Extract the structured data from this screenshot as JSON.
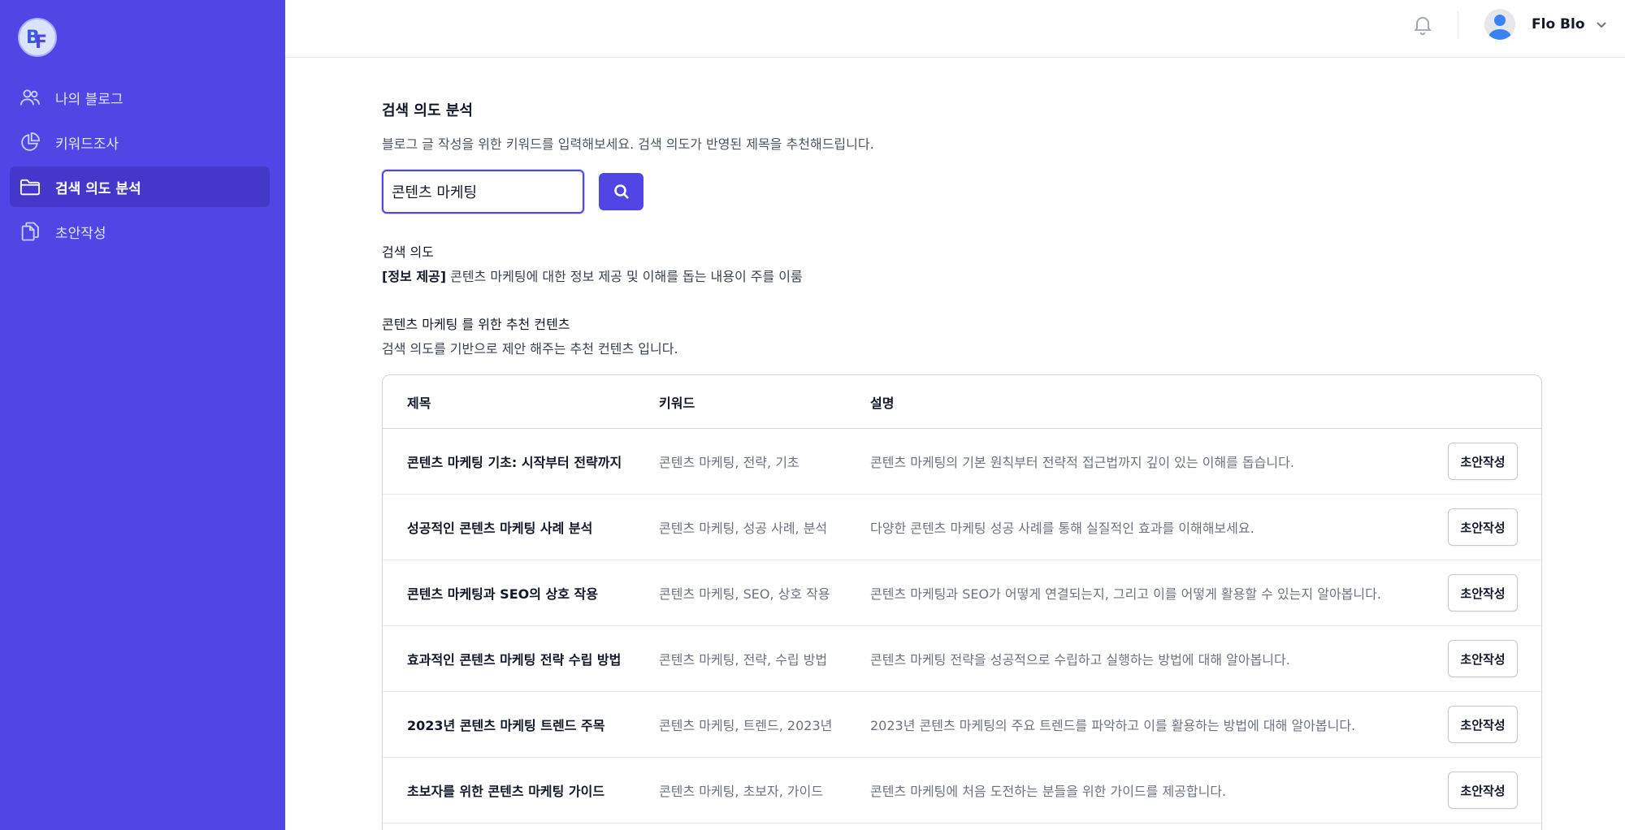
{
  "sidebar": {
    "logo_text": "BF",
    "items": [
      {
        "label": "나의 블로그",
        "icon": "users-icon",
        "active": false
      },
      {
        "label": "키워드조사",
        "icon": "pie-chart-icon",
        "active": false
      },
      {
        "label": "검색 의도 분석",
        "icon": "folder-icon",
        "active": true
      },
      {
        "label": "초안작성",
        "icon": "documents-icon",
        "active": false
      }
    ]
  },
  "header": {
    "user_name": "Flo Blo"
  },
  "main": {
    "title": "검색 의도 분석",
    "description": "블로그 글 작성을 위한 키워드를 입력해보세요. 검색 의도가 반영된 제목을 추천해드립니다.",
    "search": {
      "value": "콘텐츠 마케팅"
    },
    "intent": {
      "label": "검색 의도",
      "tag": "[정보 제공]",
      "text": " 콘텐츠 마케팅에 대한 정보 제공 및 이해를 돕는 내용이 주를 이룸"
    },
    "recommend": {
      "title": "콘텐츠 마케팅 를 위한 추천 컨텐츠",
      "description": "검색 의도를 기반으로 제안 해주는 추천 컨텐츠 입니다."
    },
    "table": {
      "headers": {
        "title": "제목",
        "keywords": "키워드",
        "description": "설명"
      },
      "action_label": "초안작성",
      "rows": [
        {
          "title": "콘텐츠 마케팅 기초: 시작부터 전략까지",
          "keywords": "콘텐츠 마케팅, 전략, 기초",
          "description": "콘텐츠 마케팅의 기본 원칙부터 전략적 접근법까지 깊이 있는 이해를 돕습니다."
        },
        {
          "title": "성공적인 콘텐츠 마케팅 사례 분석",
          "keywords": "콘텐츠 마케팅, 성공 사례, 분석",
          "description": "다양한 콘텐츠 마케팅 성공 사례를 통해 실질적인 효과를 이해해보세요."
        },
        {
          "title": "콘텐츠 마케팅과 SEO의 상호 작용",
          "keywords": "콘텐츠 마케팅, SEO, 상호 작용",
          "description": "콘텐츠 마케팅과 SEO가 어떻게 연결되는지, 그리고 이를 어떻게 활용할 수 있는지 알아봅니다."
        },
        {
          "title": "효과적인 콘텐츠 마케팅 전략 수립 방법",
          "keywords": "콘텐츠 마케팅, 전략, 수립 방법",
          "description": "콘텐츠 마케팅 전략을 성공적으로 수립하고 실행하는 방법에 대해 알아봅니다."
        },
        {
          "title": "2023년 콘텐츠 마케팅 트렌드 주목",
          "keywords": "콘텐츠 마케팅, 트렌드, 2023년",
          "description": "2023년 콘텐츠 마케팅의 주요 트렌드를 파악하고 이를 활용하는 방법에 대해 알아봅니다."
        },
        {
          "title": "초보자를 위한 콘텐츠 마케팅 가이드",
          "keywords": "콘텐츠 마케팅, 초보자, 가이드",
          "description": "콘텐츠 마케팅에 처음 도전하는 분들을 위한 가이드를 제공합니다."
        }
      ]
    }
  },
  "colors": {
    "sidebar_bg": "#4f46e5",
    "sidebar_active": "#4338ca",
    "accent": "#4f46e5"
  }
}
